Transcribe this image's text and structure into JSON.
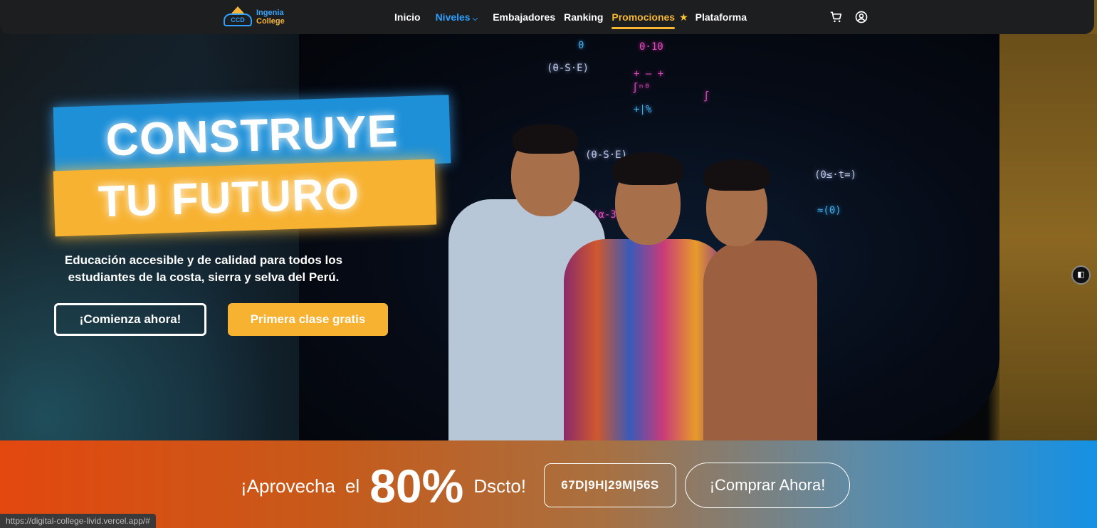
{
  "nav": {
    "logo_line1": "Ingenia",
    "logo_line2": "College",
    "logo_badge": "CCD",
    "items": [
      {
        "label": "Inicio"
      },
      {
        "label": "Niveles"
      },
      {
        "label": "Embajadores"
      },
      {
        "label": "Ranking"
      },
      {
        "label": "Promociones"
      },
      {
        "label": "Plataforma"
      }
    ],
    "cart_icon": "cart-icon",
    "user_icon": "user-circle-icon"
  },
  "hero": {
    "banner_line1": "CONSTRUYE",
    "banner_line2": "TU FUTURO",
    "subtitle": "Educación accesible y de calidad para todos los estudiantes de la costa, sierra y selva del Perú.",
    "cta_primary": "¡Comienza ahora!",
    "cta_secondary": "Primera clase gratis"
  },
  "promo": {
    "text_before": "¡Aprovecha",
    "text_el": "el",
    "percent": "80%",
    "text_after": "Dscto!",
    "countdown": "67D|9H|29M|56S",
    "buy_label": "¡Comprar Ahora!"
  },
  "status_bar": {
    "url": "https://digital-college-livid.vercel.app/#"
  },
  "colors": {
    "accent_blue": "#1e90d8",
    "accent_yellow": "#f7b231",
    "nav_bg": "#1d1e20"
  }
}
